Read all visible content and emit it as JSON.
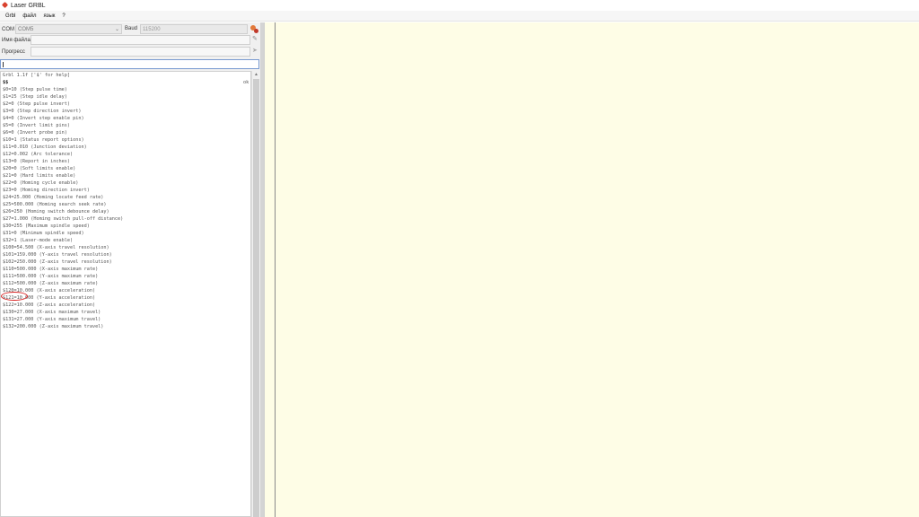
{
  "window": {
    "title": "Laser GRBL"
  },
  "menu": {
    "items": [
      "Grbl",
      "файл",
      "язык",
      "?"
    ]
  },
  "connection": {
    "port_label": "COM",
    "port_value": "COM5",
    "baud_label": "Baud",
    "baud_value": "115200"
  },
  "file": {
    "label": "Имя файла",
    "value": ""
  },
  "progress": {
    "label": "Прогресс",
    "fraction": 0
  },
  "command": {
    "value": ""
  },
  "console": {
    "lines": [
      "Grbl 1.1f ['$' for help]",
      "$$",
      "$0=10 (Step pulse time)",
      "$1=25 (Step idle delay)",
      "$2=0 (Step pulse invert)",
      "$3=0 (Step direction invert)",
      "$4=0 (Invert step enable pin)",
      "$5=0 (Invert limit pins)",
      "$6=0 (Invert probe pin)",
      "$10=1 (Status report options)",
      "$11=0.010 (Junction deviation)",
      "$12=0.002 (Arc tolerance)",
      "$13=0 (Report in inches)",
      "$20=0 (Soft limits enable)",
      "$21=0 (Hard limits enable)",
      "$22=0 (Homing cycle enable)",
      "$23=0 (Homing direction invert)",
      "$24=25.000 (Homing locate feed rate)",
      "$25=500.000 (Homing search seek rate)",
      "$26=250 (Homing switch debounce delay)",
      "$27=1.000 (Homing switch pull-off distance)",
      "$30=255 (Maximum spindle speed)",
      "$31=0 (Minimum spindle speed)",
      "$32=1 (Laser-mode enable)",
      "$100=54.500 (X-axis travel resolution)",
      "$101=159.000 (Y-axis travel resolution)",
      "$102=250.000 (Z-axis travel resolution)",
      "$110=500.000 (X-axis maximum rate)",
      "$111=500.000 (Y-axis maximum rate)",
      "$112=500.000 (Z-axis maximum rate)",
      "$120=10.000 (X-axis acceleration)",
      "$121=10.000 (Y-axis acceleration)",
      "$122=10.000 (Z-axis acceleration)",
      "$130=27.000 (X-axis maximum travel)",
      "$131=27.000 (Y-axis maximum travel)",
      "$132=200.000 (Z-axis maximum travel)"
    ],
    "ok_text": "ok"
  }
}
